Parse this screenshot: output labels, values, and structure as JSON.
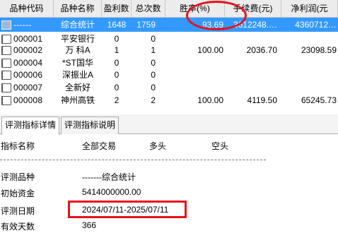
{
  "grid": {
    "headers": [
      "品种代码",
      "品种名称",
      "盈利数",
      "总次数",
      "胜率(%)",
      "手续费(元)",
      "净利润(元"
    ],
    "rows": [
      {
        "code": "------",
        "name": "综合统计",
        "wins": "1648",
        "total": "1759",
        "winrate": "93.69",
        "fee": "3612248.…",
        "profit": "4360712…",
        "selected": true
      },
      {
        "code": "000001",
        "name": "平安银行",
        "wins": "0",
        "total": "0",
        "winrate": "",
        "fee": "",
        "profit": "",
        "selected": false
      },
      {
        "code": "000002",
        "name": "万 科A",
        "wins": "1",
        "total": "1",
        "winrate": "100.00",
        "fee": "2036.70",
        "profit": "23098.59",
        "selected": false
      },
      {
        "code": "000004",
        "name": "*ST国华",
        "wins": "0",
        "total": "0",
        "winrate": "",
        "fee": "",
        "profit": "",
        "selected": false
      },
      {
        "code": "000006",
        "name": "深振业A",
        "wins": "0",
        "total": "0",
        "winrate": "",
        "fee": "",
        "profit": "",
        "selected": false
      },
      {
        "code": "000007",
        "name": "全新好",
        "wins": "0",
        "total": "0",
        "winrate": "",
        "fee": "",
        "profit": "",
        "selected": false
      },
      {
        "code": "000008",
        "name": "神州高铁",
        "wins": "2",
        "total": "2",
        "winrate": "100.00",
        "fee": "4119.50",
        "profit": "65245.73",
        "selected": false
      }
    ]
  },
  "tabs": [
    {
      "label": "评测指标详情",
      "active": true
    },
    {
      "label": "评测指标说明",
      "active": false
    }
  ],
  "detail": {
    "headers": [
      "指标名称",
      "全部交易",
      "多头",
      "空头"
    ],
    "rows": [
      {
        "label": "评测品种",
        "value": "-------综合统计"
      },
      {
        "label": "初始资金",
        "value": "5414000000.00"
      },
      {
        "label": "评测日期",
        "value": "2024/07/11-2025/07/11"
      },
      {
        "label": "有效天数",
        "value": "366"
      }
    ]
  },
  "colors": {
    "selection": "#3399ff",
    "highlight": "#e8121b",
    "header_bg": "#ececec"
  }
}
